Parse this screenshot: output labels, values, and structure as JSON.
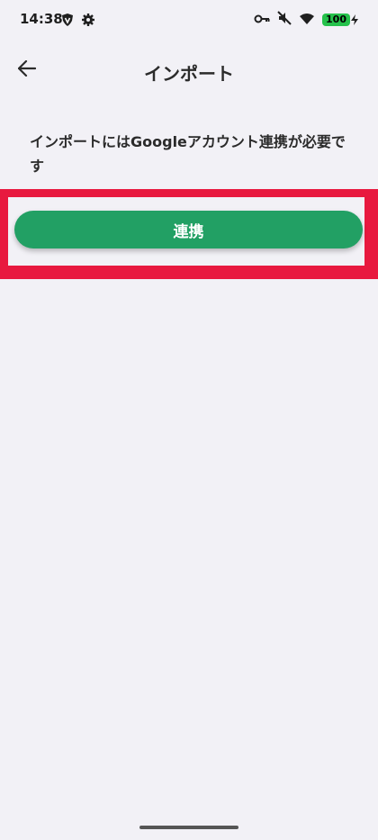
{
  "status_bar": {
    "time": "14:38",
    "battery": "100",
    "icons": [
      "vpn-shield-icon",
      "settings-gear-icon",
      "key-icon",
      "mute-icon",
      "wifi-icon",
      "battery-charging-icon"
    ]
  },
  "header": {
    "title": "インポート",
    "back_icon": "arrow-left-icon"
  },
  "main": {
    "message": "インポートにはGoogleアカウント連携が必要です",
    "link_button_label": "連携"
  },
  "colors": {
    "background": "#f2f1f6",
    "button": "#22a064",
    "highlight": "#e8193f",
    "battery": "#25c14b"
  }
}
